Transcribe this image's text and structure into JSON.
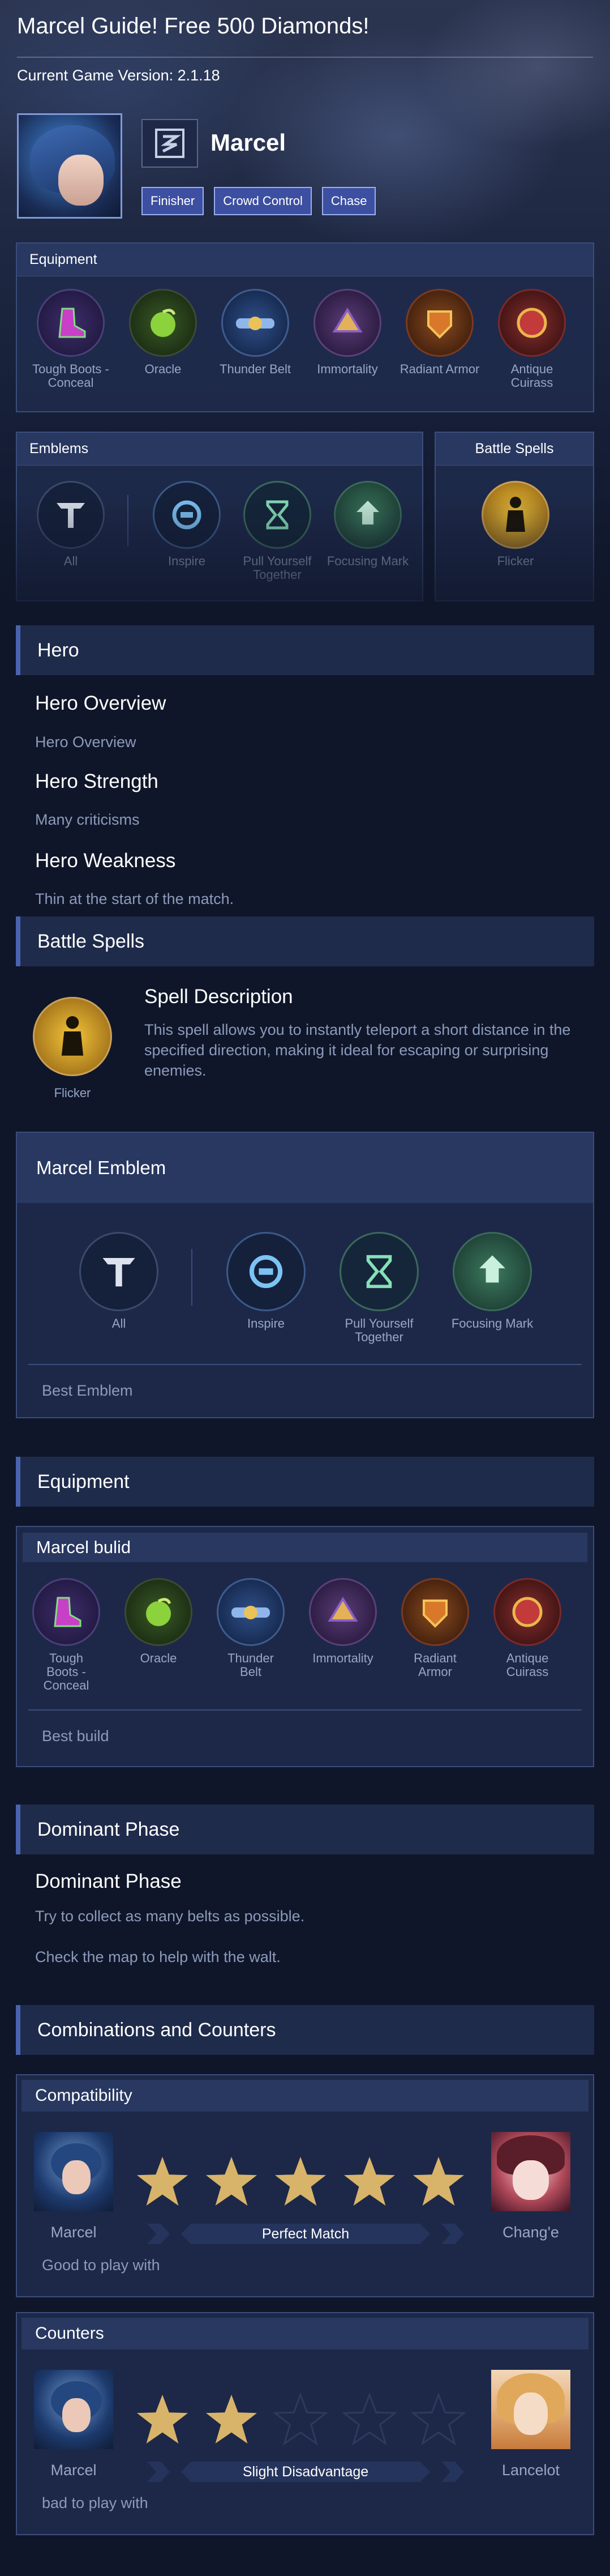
{
  "header": {
    "title": "Marcel Guide! Free 500 Diamonds!",
    "version": "Current Game Version: 2.1.18"
  },
  "hero": {
    "name": "Marcel",
    "tags": [
      "Finisher",
      "Crowd Control",
      "Chase"
    ]
  },
  "equipment_panel": {
    "title": "Equipment",
    "items": [
      "Tough Boots - Conceal",
      "Oracle",
      "Thunder Belt",
      "Immortality",
      "Radiant Armor",
      "Antique Cuirass"
    ]
  },
  "emblems_panel": {
    "title": "Emblems",
    "items": [
      "All",
      "Inspire",
      "Pull Yourself Together",
      "Focusing Mark"
    ]
  },
  "spells_panel": {
    "title": "Battle Spells",
    "spell": "Flicker"
  },
  "hero_section": {
    "title": "Hero",
    "overview_h": "Hero Overview",
    "overview_t": "Hero Overview",
    "strength_h": "Hero Strength",
    "strength_t": "Many criticisms",
    "weakness_h": "Hero Weakness",
    "weakness_t": "Thin at the start of the match."
  },
  "battle_spells_section": {
    "title": "Battle Spells",
    "spell": "Flicker",
    "desc_h": "Spell Description",
    "desc_t": "This spell allows you to instantly teleport a short distance in the specified direction, making it ideal for escaping or surprising enemies."
  },
  "emblem_section": {
    "title": "Marcel Emblem",
    "items": [
      "All",
      "Inspire",
      "Pull Yourself Together",
      "Focusing Mark"
    ],
    "footer": "Best Emblem"
  },
  "equipment_section": {
    "title": "Equipment",
    "build_title": "Marcel bulid",
    "items": [
      "Tough Boots - Conceal",
      "Oracle",
      "Thunder Belt",
      "Immortality",
      "Radiant Armor",
      "Antique Cuirass"
    ],
    "footer": "Best build"
  },
  "dominant_section": {
    "title": "Dominant Phase",
    "h": "Dominant Phase",
    "t1": "Try to collect as many belts as possible.",
    "t2": "Check the map to help with the walt."
  },
  "combos_section": {
    "title": "Combinations and Counters",
    "compat": {
      "title": "Compatibility",
      "left": "Marcel",
      "right": "Chang'e",
      "rating": 5,
      "match": "Perfect Match",
      "note": "Good to play with"
    },
    "counters": {
      "title": "Counters",
      "left": "Marcel",
      "right": "Lancelot",
      "rating": 2,
      "match": "Slight Disadvantage",
      "note": "bad to play with"
    }
  },
  "colors": {
    "background": "#0f1629",
    "panel": "#202c4e",
    "accent": "#4a63b0",
    "tag": "#3c4fa0",
    "star_gold": "#d8b46a"
  }
}
